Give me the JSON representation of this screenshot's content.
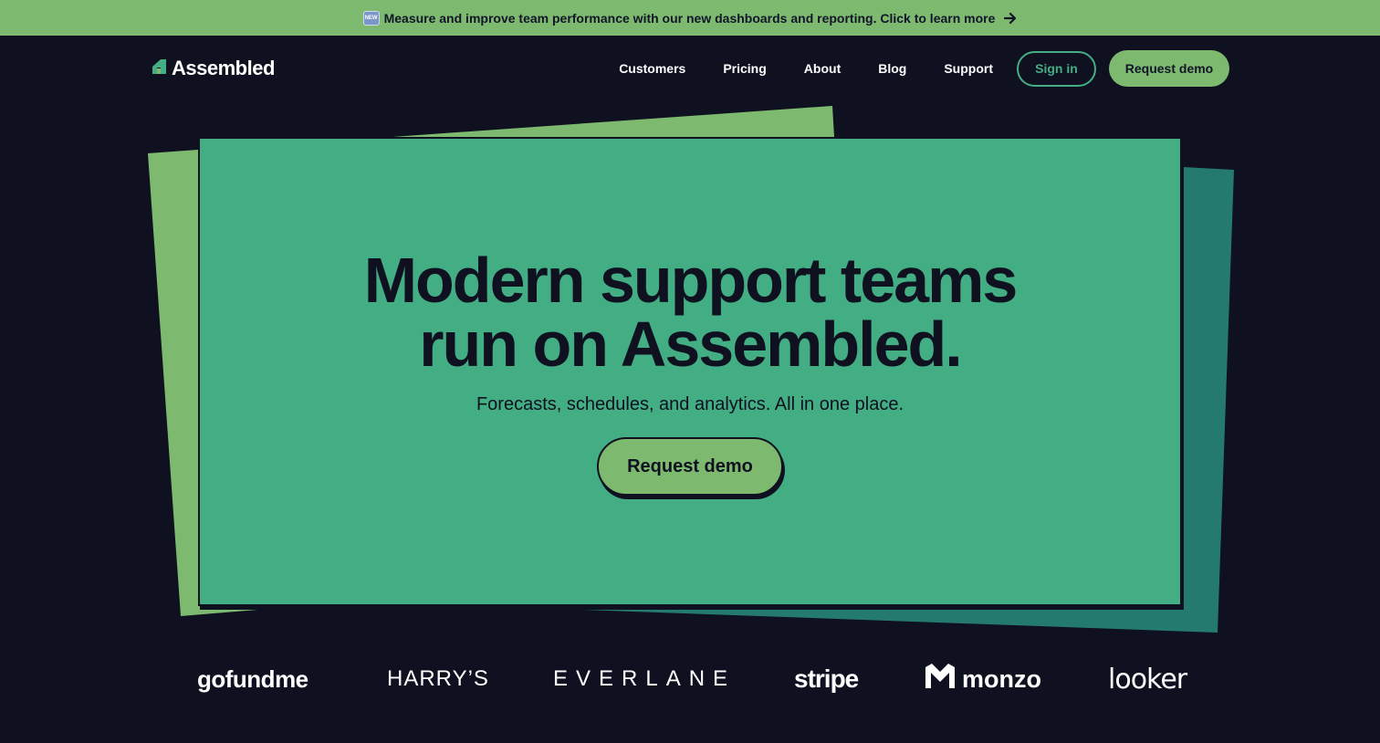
{
  "announcement": {
    "badge": "NEW",
    "text": "Measure and improve team performance with our new dashboards and reporting. Click to learn more",
    "icon": "arrow-right-icon"
  },
  "header": {
    "logo_text": "Assembled",
    "nav": [
      "Customers",
      "Pricing",
      "About",
      "Blog",
      "Support"
    ],
    "signin_label": "Sign in",
    "demo_label": "Request demo"
  },
  "hero": {
    "title": "Modern support teams run on Assembled.",
    "subtitle": "Forecasts, schedules, and analytics. All in one place.",
    "cta_label": "Request demo"
  },
  "customers": {
    "logos": [
      "gofundme",
      "HARRY’S",
      "EVERLANE",
      "stripe",
      "monzo",
      "looker"
    ]
  },
  "colors": {
    "background": "#0f1120",
    "announcement": "#7dba6f",
    "hero_card": "#43ad83",
    "accent_green": "#7dba6f",
    "accent_teal": "#257a6f"
  }
}
